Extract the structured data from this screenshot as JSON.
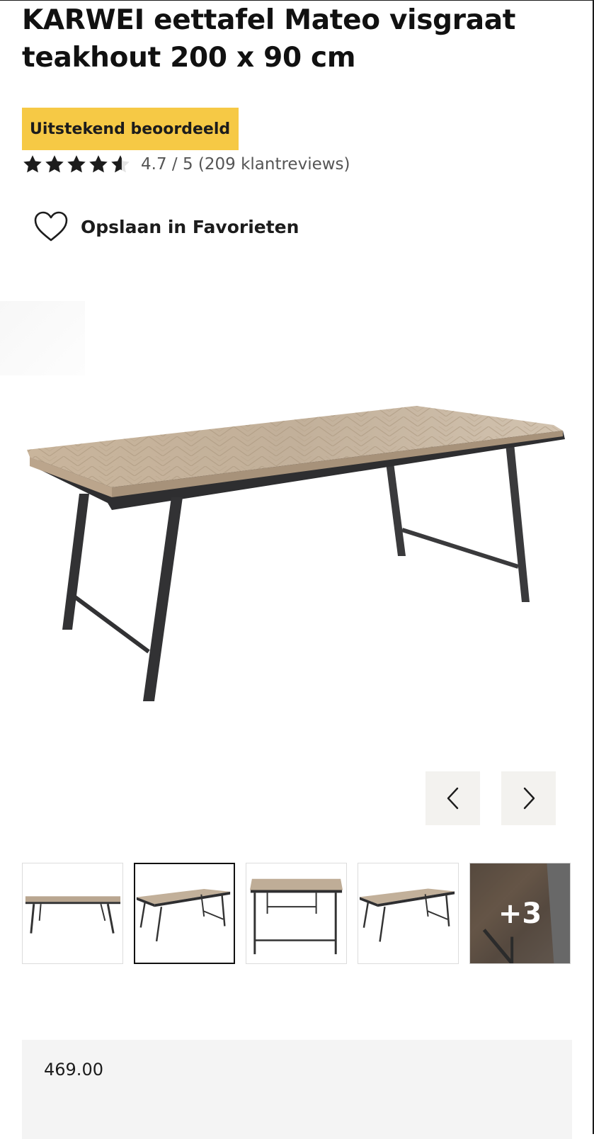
{
  "product": {
    "title_line1": "KARWEI eettafel Mateo visgraat",
    "title_line2": "teakhout 200 x 90 cm",
    "badge": "Uitstekend beoordeeld",
    "rating": {
      "value": 4.7,
      "max": 5,
      "text": "4.7 / 5 (209 klantreviews)"
    },
    "favorite_label": "Opslaan in Favorieten",
    "price": "469.00"
  },
  "gallery": {
    "prev_icon": "chevron-left-icon",
    "next_icon": "chevron-right-icon",
    "selected_index": 1,
    "more_label": "+3"
  },
  "colors": {
    "badge_bg": "#f6c945",
    "nav_button_bg": "#f3f2ef",
    "price_panel_bg": "#f4f4f4",
    "text": "#1c1c1c"
  }
}
